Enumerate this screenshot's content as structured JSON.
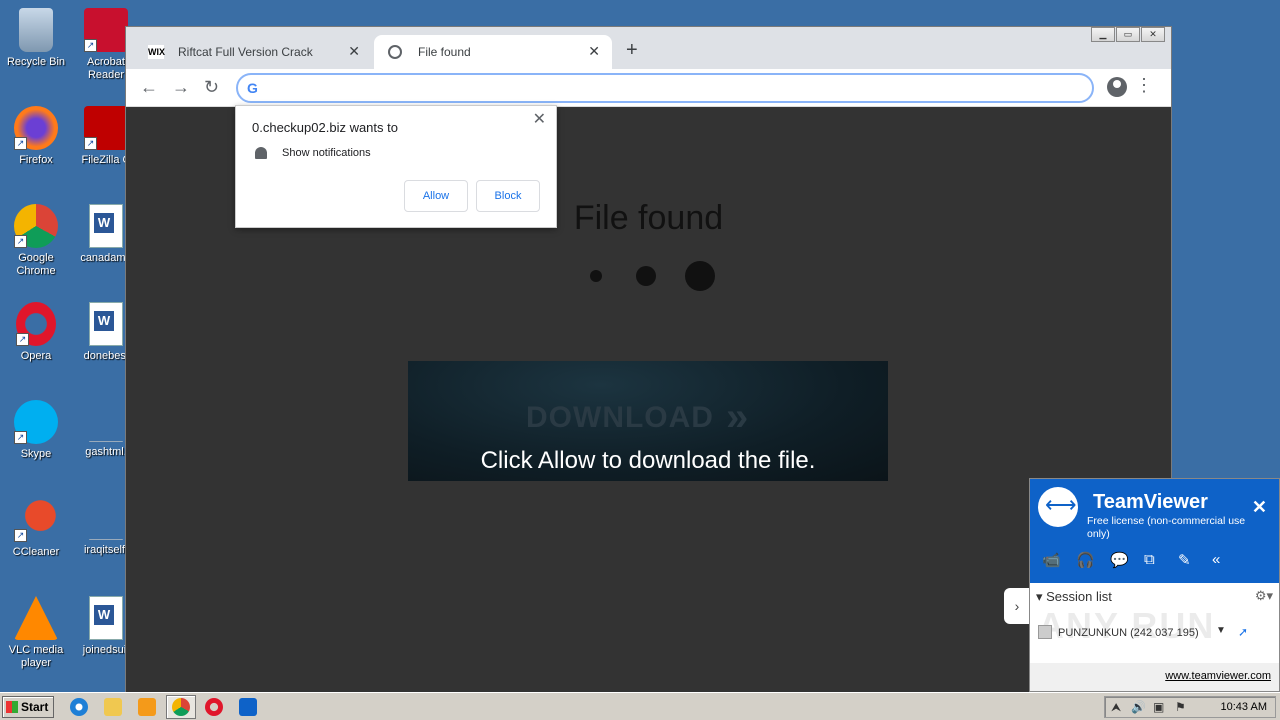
{
  "desktop": {
    "icons": [
      {
        "label": "Recycle Bin",
        "icon": "recycle-bin-icon"
      },
      {
        "label": "Acrobat Reader",
        "icon": "acrobat-reader-icon"
      },
      {
        "label": "Firefox",
        "icon": "firefox-icon"
      },
      {
        "label": "FileZilla C",
        "icon": "filezilla-icon"
      },
      {
        "label": "Google Chrome",
        "icon": "chrome-icon"
      },
      {
        "label": "canadame",
        "icon": "word-doc-icon"
      },
      {
        "label": "Opera",
        "icon": "opera-icon"
      },
      {
        "label": "donebesl",
        "icon": "word-doc-icon"
      },
      {
        "label": "Skype",
        "icon": "skype-icon"
      },
      {
        "label": "gashtml.",
        "icon": "file-icon"
      },
      {
        "label": "CCleaner",
        "icon": "ccleaner-icon"
      },
      {
        "label": "iraqitself.",
        "icon": "file-icon"
      },
      {
        "label": "VLC media player",
        "icon": "vlc-icon"
      },
      {
        "label": "joinedsuit",
        "icon": "word-doc-icon"
      }
    ]
  },
  "browser": {
    "tabs": [
      {
        "title": "Riftcat Full Version Crack",
        "favicon": "WIX",
        "active": false
      },
      {
        "title": "File found",
        "favicon": "globe-icon",
        "active": true
      }
    ],
    "close_glyph": "✕",
    "newtab_glyph": "+",
    "window_buttons": [
      "▁",
      "▭",
      "✕"
    ],
    "nav": {
      "back": "←",
      "forward": "→",
      "reload": "↻",
      "menu": "⋮"
    },
    "address": {
      "value": "",
      "g_logo": "G"
    },
    "page": {
      "heading": "File found",
      "banner_text": "DOWNLOAD",
      "banner_chevrons": "»",
      "caption": "Click Allow to download the file."
    },
    "notification": {
      "title": "0.checkup02.biz wants to",
      "message": "Show notifications",
      "allow": "Allow",
      "block": "Block",
      "close": "✕"
    }
  },
  "teamviewer": {
    "name": "TeamViewer",
    "license": "Free license (non-commercial use only)",
    "close": "✕",
    "tools": [
      "📹",
      "🎧",
      "💬",
      "⧉",
      "✎",
      "«"
    ],
    "session_header": "▾ Session list",
    "gear": "⚙▾",
    "partner": "PUNZUNKUN (242 037 195)",
    "dropdown": "▼",
    "pointer": "➚",
    "link": "www.teamviewer.com",
    "expander": "›",
    "watermark": "ANY RUN"
  },
  "taskbar": {
    "start": "Start",
    "clock": "10:43 AM",
    "tray_glyphs": [
      "⮝",
      "🔊",
      "▣",
      "⚑"
    ]
  },
  "colors": {
    "desktop_bg": "#3a6ea5",
    "page_bg": "#333333",
    "teamviewer_blue": "#0e62c8",
    "link_blue": "#1a73e8"
  }
}
